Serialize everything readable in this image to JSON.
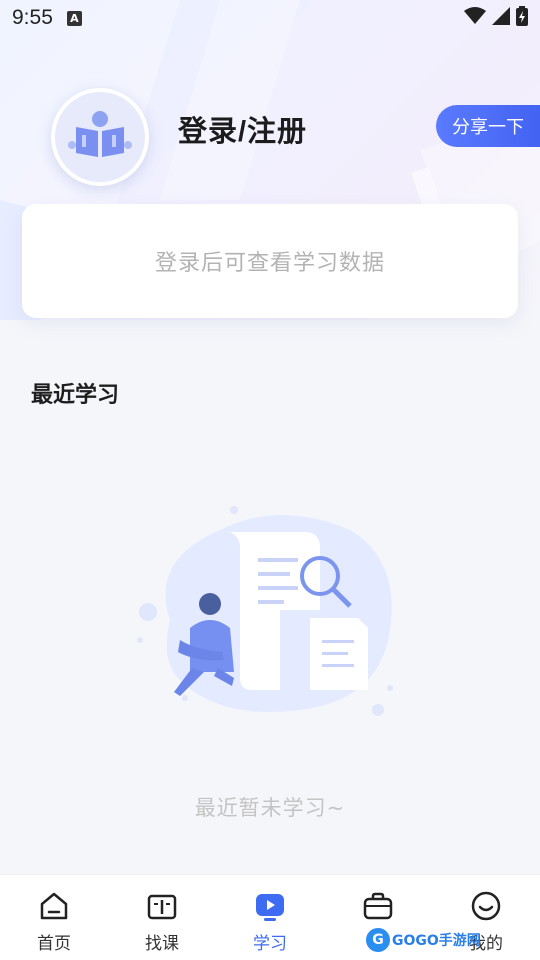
{
  "status_bar": {
    "time": "9:55",
    "notification_icon": "text-a-icon",
    "icons": [
      "wifi-icon",
      "signal-icon",
      "battery-charging-icon"
    ]
  },
  "profile": {
    "avatar_icon": "book-reader-icon",
    "login_label": "登录/注册",
    "share_label": "分享一下"
  },
  "stats_card": {
    "message": "登录后可查看学习数据"
  },
  "recent": {
    "title": "最近学习",
    "empty_icon": "empty-study-illustration",
    "empty_message": "最近暂未学习~"
  },
  "bottom_nav": {
    "items": [
      {
        "label": "首页",
        "icon": "home-icon",
        "active": false
      },
      {
        "label": "找课",
        "icon": "open-book-icon",
        "active": false
      },
      {
        "label": "学习",
        "icon": "play-icon",
        "active": true
      },
      {
        "label": "习",
        "icon": "bag-icon",
        "active": false
      },
      {
        "label": "我的",
        "icon": "smile-face-icon",
        "active": false
      }
    ]
  },
  "watermark": {
    "logo_letter": "G",
    "text": "GOGO手游网"
  },
  "colors": {
    "accent": "#3d6cf2",
    "share_gradient_start": "#5a7bff",
    "share_gradient_end": "#3f5ff0",
    "background": "#f5f6fa",
    "muted_text": "#b3b3b3"
  }
}
